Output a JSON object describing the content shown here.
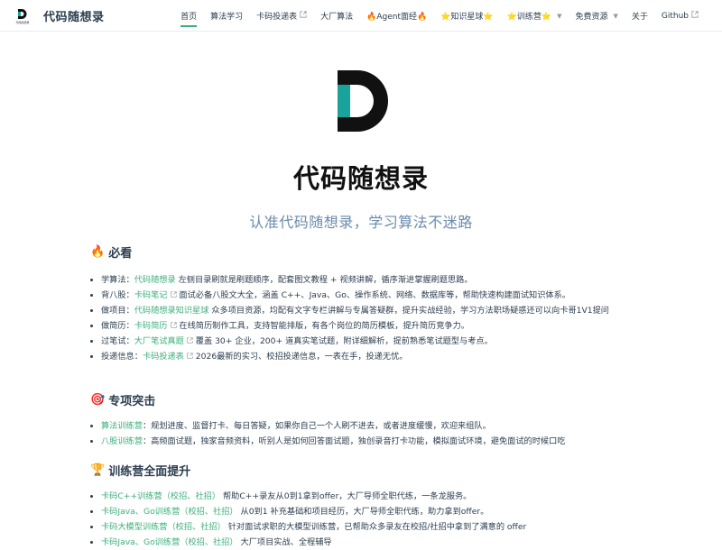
{
  "nav": {
    "site_name": "代码随想录",
    "logo_caption": "代码随想录",
    "items": [
      {
        "label": "首页",
        "active": true
      },
      {
        "label": "算法学习"
      },
      {
        "label": "卡码投递表",
        "external": true
      },
      {
        "label": "大厂算法"
      },
      {
        "label": "🔥Agent面经🔥"
      },
      {
        "label": "⭐知识星球⭐"
      },
      {
        "label": "⭐训练营⭐",
        "dropdown": true
      },
      {
        "label": "免费资源",
        "dropdown": true
      },
      {
        "label": "关于"
      },
      {
        "label": "Github",
        "external": true
      }
    ]
  },
  "hero": {
    "logo_letter": "D",
    "title": "代码随想录",
    "description": "认准代码随想录，学习算法不迷路"
  },
  "sections": {
    "must_read": {
      "emoji": "🔥",
      "title": "必看",
      "items": [
        {
          "prefix": "学算法：",
          "link": "代码随想录",
          "external": false,
          "text": " 左侧目录刷就是刷题顺序，配套图文教程 + 视频讲解，循序渐进掌握刷题思路。"
        },
        {
          "prefix": "背八股：",
          "link": "卡码笔记",
          "external": true,
          "text": " 面试必备八股文大全，涵盖 C++、Java、Go、操作系统、网络、数据库等，帮助快速构建面试知识体系。"
        },
        {
          "prefix": "做项目：",
          "link": "代码随想录知识星球",
          "external": false,
          "text": " 众多项目资源，均配有文字专栏讲解与专属答疑群，提升实战经验，学习方法职场疑惑还可以向卡哥1V1提问"
        },
        {
          "prefix": "做简历：",
          "link": "卡码简历",
          "external": true,
          "text": " 在线简历制作工具，支持智能排版，有各个岗位的简历模板，提升简历竞争力。"
        },
        {
          "prefix": "过笔试：",
          "link": "大厂笔试真题",
          "external": true,
          "text": " 覆盖 30+ 企业，200+ 道真实笔试题，附详细解析，提前熟悉笔试题型与考点。"
        },
        {
          "prefix": "投递信息：",
          "link": "卡码投递表",
          "external": true,
          "text": " 2026最新的实习、校招投递信息，一表在手，投递无忧。"
        }
      ]
    },
    "focus": {
      "emoji": "🎯",
      "title": "专项突击",
      "items": [
        {
          "prefix": "",
          "link": "算法训练营",
          "external": false,
          "text": "：规划进度、监督打卡、每日答疑，如果你自己一个人刷不进去，或者进度缓慢，欢迎来组队。"
        },
        {
          "prefix": "",
          "link": "八股训练营",
          "external": false,
          "text": "：高频面试题，独家音频资料，听别人是如何回答面试题，独创录音打卡功能，模拟面试环境，避免面试的时候口吃"
        }
      ]
    },
    "camps": {
      "emoji": "🏆",
      "title": "训练营全面提升",
      "items": [
        {
          "prefix": "",
          "link": "卡码C++训练营（校招、社招）",
          "external": false,
          "text": " 帮助C++录友从0到1拿到offer，大厂导师全职代练，一条龙服务。"
        },
        {
          "prefix": "",
          "link": "卡码Java、Go训练营（校招、社招）",
          "external": false,
          "text": " 从0到1 补充基础和项目经历，大厂导师全职代练，助力拿到offer。"
        },
        {
          "prefix": "",
          "link": "卡码大模型训练营（校招、社招）",
          "external": false,
          "text": " 针对面试求职的大模型训练营，已帮助众多录友在校招/社招中拿到了满意的 offer"
        },
        {
          "prefix": "",
          "link": "卡码Java、Go训练营（校招、社招）",
          "external": false,
          "text": " 大厂项目实战、全程辅导"
        }
      ]
    }
  },
  "colors": {
    "accent": "#3eaf7c",
    "text": "#2c3e50",
    "logo_teal": "#1aa39a",
    "logo_dark": "#111111"
  }
}
